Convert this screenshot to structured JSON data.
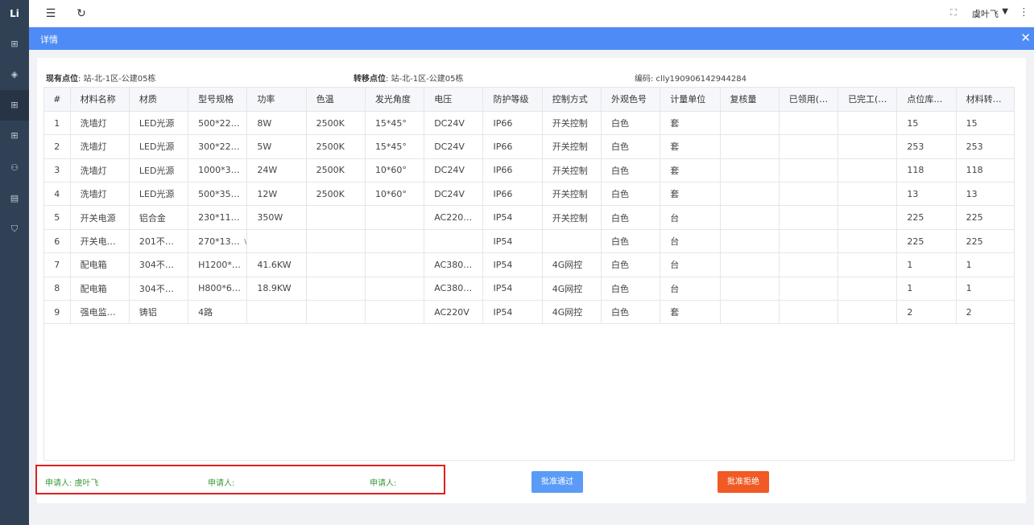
{
  "sidebar": {
    "logo": "Li",
    "items": [
      {
        "icon": "clipboard-icon",
        "glyph": "⊞"
      },
      {
        "icon": "layers-icon",
        "glyph": "◈"
      },
      {
        "icon": "clipboard-check-icon",
        "glyph": "⊞"
      },
      {
        "icon": "clipboard-edit-icon",
        "glyph": "⊞"
      },
      {
        "icon": "user-icon",
        "glyph": "⚇"
      },
      {
        "icon": "document-icon",
        "glyph": "▤"
      },
      {
        "icon": "shield-icon",
        "glyph": "⛉"
      }
    ]
  },
  "topbar": {
    "menu_icon": "☰",
    "refresh_icon": "↻",
    "fullscreen_icon": "⛶",
    "user": "虞叶飞",
    "caret": "▼",
    "more": "⋮"
  },
  "dialog": {
    "title": "详情",
    "close": "✕"
  },
  "meta": {
    "current_label": "现有点位",
    "current_value": ": 站-北-1区-公建05栋",
    "transfer_label": "转移点位",
    "transfer_value": ": 站-北-1区-公建05栋",
    "code": "编码: clly190906142944284"
  },
  "table": {
    "columns": [
      "#",
      "材料名称",
      "材质",
      "型号规格",
      "功率",
      "色温",
      "发光角度",
      "电压",
      "防护等级",
      "控制方式",
      "外观色号",
      "计量单位",
      "复核量",
      "已领用(…",
      "已完工(…",
      "点位库…",
      "材料转…"
    ],
    "rows": [
      [
        "1",
        "洗墙灯",
        "LED光源",
        "500*22…",
        "8W",
        "2500K",
        "15*45°",
        "DC24V",
        "IP66",
        "开关控制",
        "白色",
        "套",
        "",
        "",
        "",
        "15",
        "15"
      ],
      [
        "2",
        "洗墙灯",
        "LED光源",
        "300*22…",
        "5W",
        "2500K",
        "15*45°",
        "DC24V",
        "IP66",
        "开关控制",
        "白色",
        "套",
        "",
        "",
        "",
        "253",
        "253"
      ],
      [
        "3",
        "洗墙灯",
        "LED光源",
        "1000*3…",
        "24W",
        "2500K",
        "10*60°",
        "DC24V",
        "IP66",
        "开关控制",
        "白色",
        "套",
        "",
        "",
        "",
        "118",
        "118"
      ],
      [
        "4",
        "洗墙灯",
        "LED光源",
        "500*35…",
        "12W",
        "2500K",
        "10*60°",
        "DC24V",
        "IP66",
        "开关控制",
        "白色",
        "套",
        "",
        "",
        "",
        "13",
        "13"
      ],
      [
        "5",
        "开关电源",
        "铝合金",
        "230*11…",
        "350W",
        "",
        "",
        "AC220…",
        "IP54",
        "开关控制",
        "白色",
        "台",
        "",
        "",
        "",
        "225",
        "225"
      ],
      [
        "6",
        "开关电…",
        "201不…",
        "270*13…",
        "",
        "",
        "",
        "",
        "IP54",
        "",
        "白色",
        "台",
        "",
        "",
        "",
        "225",
        "225"
      ],
      [
        "7",
        "配电箱",
        "304不…",
        "H1200*…",
        "41.6KW",
        "",
        "",
        "AC380…",
        "IP54",
        "4G网控",
        "白色",
        "台",
        "",
        "",
        "",
        "1",
        "1"
      ],
      [
        "8",
        "配电箱",
        "304不…",
        "H800*6…",
        "18.9KW",
        "",
        "",
        "AC380…",
        "IP54",
        "4G网控",
        "白色",
        "台",
        "",
        "",
        "",
        "1",
        "1"
      ],
      [
        "9",
        "强电监…",
        "铸铝",
        "4路",
        "",
        "",
        "",
        "AC220V",
        "IP54",
        "4G网控",
        "白色",
        "套",
        "",
        "",
        "",
        "2",
        "2"
      ]
    ]
  },
  "signatures": [
    "申请人: 虞叶飞",
    "申请人:",
    "申请人:"
  ],
  "buttons": {
    "approve": "批准通过",
    "reject": "批准拒绝"
  },
  "colors": {
    "sidebar": "#304156",
    "header": "#4e8bf6",
    "approve": "#5b9bf8",
    "reject": "#f05a24",
    "highlight": "#e02020"
  }
}
